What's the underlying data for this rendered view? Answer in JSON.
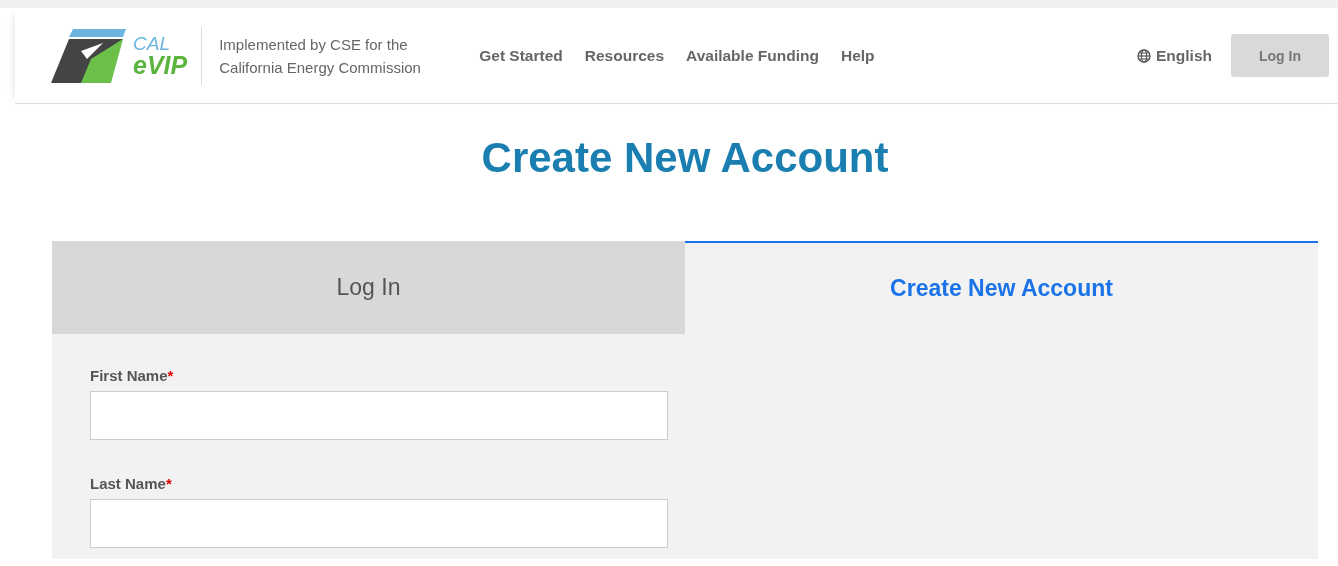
{
  "header": {
    "logo": {
      "top": "CAL",
      "bottom": "eVIP"
    },
    "tagline": "Implemented by CSE for the California Energy Commission",
    "nav": [
      "Get Started",
      "Resources",
      "Available Funding",
      "Help"
    ],
    "language": "English",
    "login_button": "Log In"
  },
  "page_title": "Create New Account",
  "tabs": [
    {
      "label": "Log In",
      "selected": false
    },
    {
      "label": "Create New Account",
      "selected": true
    }
  ],
  "form": {
    "fields": [
      {
        "label": "First Name",
        "required_mark": "*"
      },
      {
        "label": "Last Name",
        "required_mark": "*"
      }
    ]
  }
}
